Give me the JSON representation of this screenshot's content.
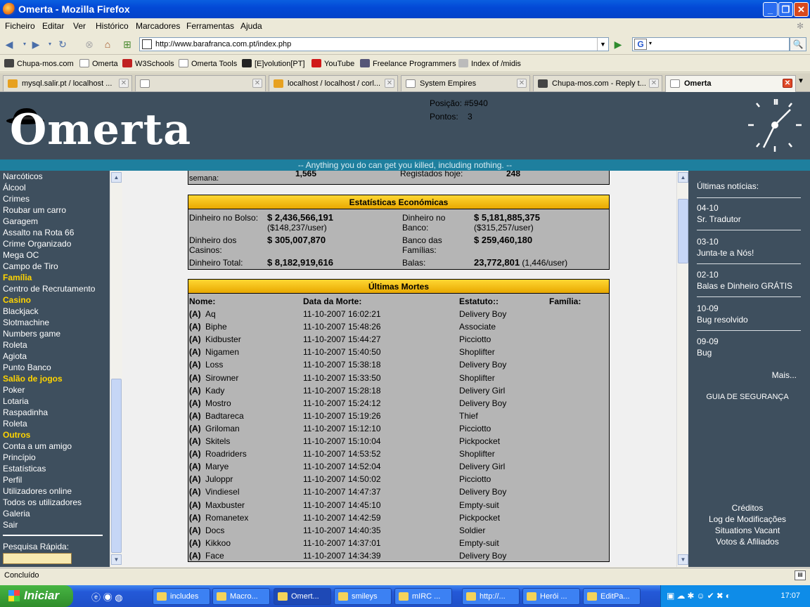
{
  "window": {
    "title": "Omerta - Mozilla Firefox"
  },
  "menu": [
    "Ficheiro",
    "Editar",
    "Ver",
    "Histórico",
    "Marcadores",
    "Ferramentas",
    "Ajuda"
  ],
  "url": "http://www.barafranca.com.pt/index.php",
  "search_value": "",
  "bookmarks": [
    "Chupa-mos.com",
    "Omerta",
    "W3Schools",
    "Omerta Tools",
    "",
    "[E]volution[PT]",
    "YouTube",
    "Freelance Programmers",
    "Index of /midis"
  ],
  "tabs": [
    {
      "label": "mysql.salir.pt / localhost ..."
    },
    {
      "label": ""
    },
    {
      "label": "localhost / localhost / corl..."
    },
    {
      "label": "System Empires"
    },
    {
      "label": "Chupa-mos.com - Reply t..."
    },
    {
      "label": "Omerta"
    }
  ],
  "header": {
    "logo": "Omerta",
    "position_label": "Posição:",
    "position_value": "#5940",
    "points_label": "Pontos:",
    "points_value": "3",
    "slogan": "-- Anything you do can get you killed, including nothing. --"
  },
  "leftnav": [
    {
      "label": "Narcóticos",
      "cat": false
    },
    {
      "label": "Álcool",
      "cat": false
    },
    {
      "label": "Crimes",
      "cat": false
    },
    {
      "label": "Roubar um carro",
      "cat": false
    },
    {
      "label": "Garagem",
      "cat": false
    },
    {
      "label": "Assalto na Rota 66",
      "cat": false
    },
    {
      "label": "Crime Organizado",
      "cat": false
    },
    {
      "label": "Mega OC",
      "cat": false
    },
    {
      "label": "Campo de Tiro",
      "cat": false
    },
    {
      "label": "Família",
      "cat": true
    },
    {
      "label": "Centro de Recrutamento",
      "cat": false
    },
    {
      "label": "Casino",
      "cat": true
    },
    {
      "label": "Blackjack",
      "cat": false
    },
    {
      "label": "Slotmachine",
      "cat": false
    },
    {
      "label": "Numbers game",
      "cat": false
    },
    {
      "label": "Roleta",
      "cat": false
    },
    {
      "label": "Agiota",
      "cat": false
    },
    {
      "label": "Punto Banco",
      "cat": false
    },
    {
      "label": "Salão de jogos",
      "cat": true
    },
    {
      "label": "Poker",
      "cat": false
    },
    {
      "label": "Lotaria",
      "cat": false
    },
    {
      "label": "Raspadinha",
      "cat": false
    },
    {
      "label": "Roleta",
      "cat": false
    },
    {
      "label": "Outros",
      "cat": true
    },
    {
      "label": "Conta a um amigo",
      "cat": false
    },
    {
      "label": "Princípio",
      "cat": false
    },
    {
      "label": "Estatísticas",
      "cat": false
    },
    {
      "label": "Perfil",
      "cat": false
    },
    {
      "label": "Utilizadores online",
      "cat": false
    },
    {
      "label": "Todos os utilizadores",
      "cat": false
    },
    {
      "label": "Galeria",
      "cat": false
    },
    {
      "label": "Sair",
      "cat": false
    }
  ],
  "quick_search_label": "Pesquisa Rápida:",
  "top_partial": {
    "left_label": "semana:",
    "left_value": "1,565",
    "right_label": "Registados hoje:",
    "right_value": "248"
  },
  "econ": {
    "title": "Estatísticas Económicas",
    "pocket_label": "Dinheiro no Bolso:",
    "pocket_value": "$ 2,436,566,191",
    "pocket_per": "($148,237/user)",
    "bank_label_1": "Dinheiro no",
    "bank_label_2": "Banco:",
    "bank_value": "$ 5,181,885,375",
    "bank_per": "($315,257/user)",
    "casino_label_1": "Dinheiro dos",
    "casino_label_2": "Casinos:",
    "casino_value": "$ 305,007,870",
    "family_label_1": "Banco das",
    "family_label_2": "Famílias:",
    "family_value": "$ 259,460,180",
    "total_label": "Dinheiro Total:",
    "total_value": "$ 8,182,919,616",
    "bullets_label": "Balas:",
    "bullets_value": "23,772,801",
    "bullets_per": "(1,446/user)"
  },
  "deaths": {
    "title": "Últimas Mortes",
    "col_name": "Nome:",
    "col_date": "Data da Morte:",
    "col_status": "Estatuto::",
    "col_family": "Família:",
    "rows": [
      {
        "tag": "(A)",
        "name": "Aq",
        "date": "11-10-2007 16:02:21",
        "status": "Delivery Boy"
      },
      {
        "tag": "(A)",
        "name": "Biphe",
        "date": "11-10-2007 15:48:26",
        "status": "Associate"
      },
      {
        "tag": "(A)",
        "name": "Kidbuster",
        "date": "11-10-2007 15:44:27",
        "status": "Picciotto"
      },
      {
        "tag": "(A)",
        "name": "Nigamen",
        "date": "11-10-2007 15:40:50",
        "status": "Shoplifter"
      },
      {
        "tag": "(A)",
        "name": "Loss",
        "date": "11-10-2007 15:38:18",
        "status": "Delivery Boy"
      },
      {
        "tag": "(A)",
        "name": "Sirowner",
        "date": "11-10-2007 15:33:50",
        "status": "Shoplifter"
      },
      {
        "tag": "(A)",
        "name": "Kady",
        "date": "11-10-2007 15:28:18",
        "status": "Delivery Girl"
      },
      {
        "tag": "(A)",
        "name": "Mostro",
        "date": "11-10-2007 15:24:12",
        "status": "Delivery Boy"
      },
      {
        "tag": "(A)",
        "name": "Badtareca",
        "date": "11-10-2007 15:19:26",
        "status": "Thief"
      },
      {
        "tag": "(A)",
        "name": "Griloman",
        "date": "11-10-2007 15:12:10",
        "status": "Picciotto"
      },
      {
        "tag": "(A)",
        "name": "Skitels",
        "date": "11-10-2007 15:10:04",
        "status": "Pickpocket"
      },
      {
        "tag": "(A)",
        "name": "Roadriders",
        "date": "11-10-2007 14:53:52",
        "status": "Shoplifter"
      },
      {
        "tag": "(A)",
        "name": "Marye",
        "date": "11-10-2007 14:52:04",
        "status": "Delivery Girl"
      },
      {
        "tag": "(A)",
        "name": "Juloppr",
        "date": "11-10-2007 14:50:02",
        "status": "Picciotto"
      },
      {
        "tag": "(A)",
        "name": "Vindiesel",
        "date": "11-10-2007 14:47:37",
        "status": "Delivery Boy"
      },
      {
        "tag": "(A)",
        "name": "Maxbuster",
        "date": "11-10-2007 14:45:10",
        "status": "Empty-suit"
      },
      {
        "tag": "(A)",
        "name": "Romanetex",
        "date": "11-10-2007 14:42:59",
        "status": "Pickpocket"
      },
      {
        "tag": "(A)",
        "name": "Docs",
        "date": "11-10-2007 14:40:35",
        "status": "Soldier"
      },
      {
        "tag": "(A)",
        "name": "Kikkoo",
        "date": "11-10-2007 14:37:01",
        "status": "Empty-suit"
      },
      {
        "tag": "(A)",
        "name": "Face",
        "date": "11-10-2007 14:34:39",
        "status": "Delivery Boy"
      }
    ]
  },
  "news": {
    "title": "Últimas notícias:",
    "items": [
      {
        "date": "04-10",
        "text": "Sr. Tradutor"
      },
      {
        "date": "03-10",
        "text": "Junta-te a Nós!"
      },
      {
        "date": "02-10",
        "text": "Balas e Dinheiro GRÁTIS"
      },
      {
        "date": "10-09",
        "text": "Bug resolvido"
      },
      {
        "date": "09-09",
        "text": "Bug"
      }
    ],
    "more": "Mais...",
    "security": "GUIA DE SEGURANÇA"
  },
  "footer_links": [
    "Créditos",
    "Log de Modificações",
    "Situations Vacant",
    "Votos & Afiliados"
  ],
  "status_text": "Concluído",
  "taskbar": {
    "start": "Iniciar",
    "tasks": [
      "includes",
      "Macro...",
      "Omert...",
      "smileys",
      "mIRC ...",
      "http://...",
      "Herói ...",
      "EditPa..."
    ],
    "clock": "17:07"
  },
  "colors": {
    "header_bg": "#3e4f5e",
    "accent_yellow": "#ffd400",
    "slogan_bar": "#1e7f9e",
    "panel_bg": "#b5b5b5"
  }
}
